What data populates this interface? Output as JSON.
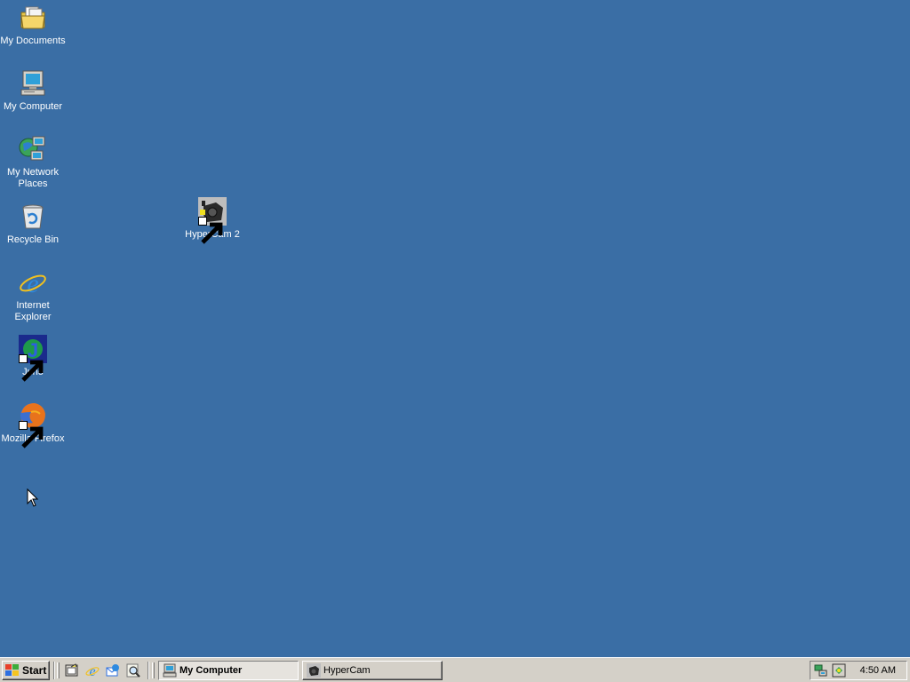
{
  "desktop": {
    "background_color": "#3a6ea5",
    "icons": [
      {
        "label": "My Documents",
        "icon": "folder-documents-icon"
      },
      {
        "label": "My Computer",
        "icon": "computer-icon"
      },
      {
        "label": "My Network Places",
        "icon": "network-places-icon"
      },
      {
        "label": "Recycle Bin",
        "icon": "recycle-bin-icon"
      },
      {
        "label": "Internet Explorer",
        "icon": "internet-explorer-icon"
      },
      {
        "label": "Juno",
        "icon": "juno-icon"
      },
      {
        "label": "Mozilla Firefox",
        "icon": "firefox-icon"
      },
      {
        "label": "HyperCam 2",
        "icon": "hypercam-icon"
      }
    ]
  },
  "taskbar": {
    "start_label": "Start",
    "quick_launch": [
      "show-desktop-icon",
      "internet-explorer-icon",
      "outlook-express-icon",
      "search-icon"
    ],
    "tasks": [
      {
        "label": "My Computer",
        "active": true,
        "icon": "computer-icon"
      },
      {
        "label": "HyperCam",
        "active": false,
        "icon": "hypercam-icon"
      }
    ],
    "tray_icons": [
      "network-icon",
      "hypercam-tray-icon"
    ],
    "clock": "4:50 AM"
  }
}
